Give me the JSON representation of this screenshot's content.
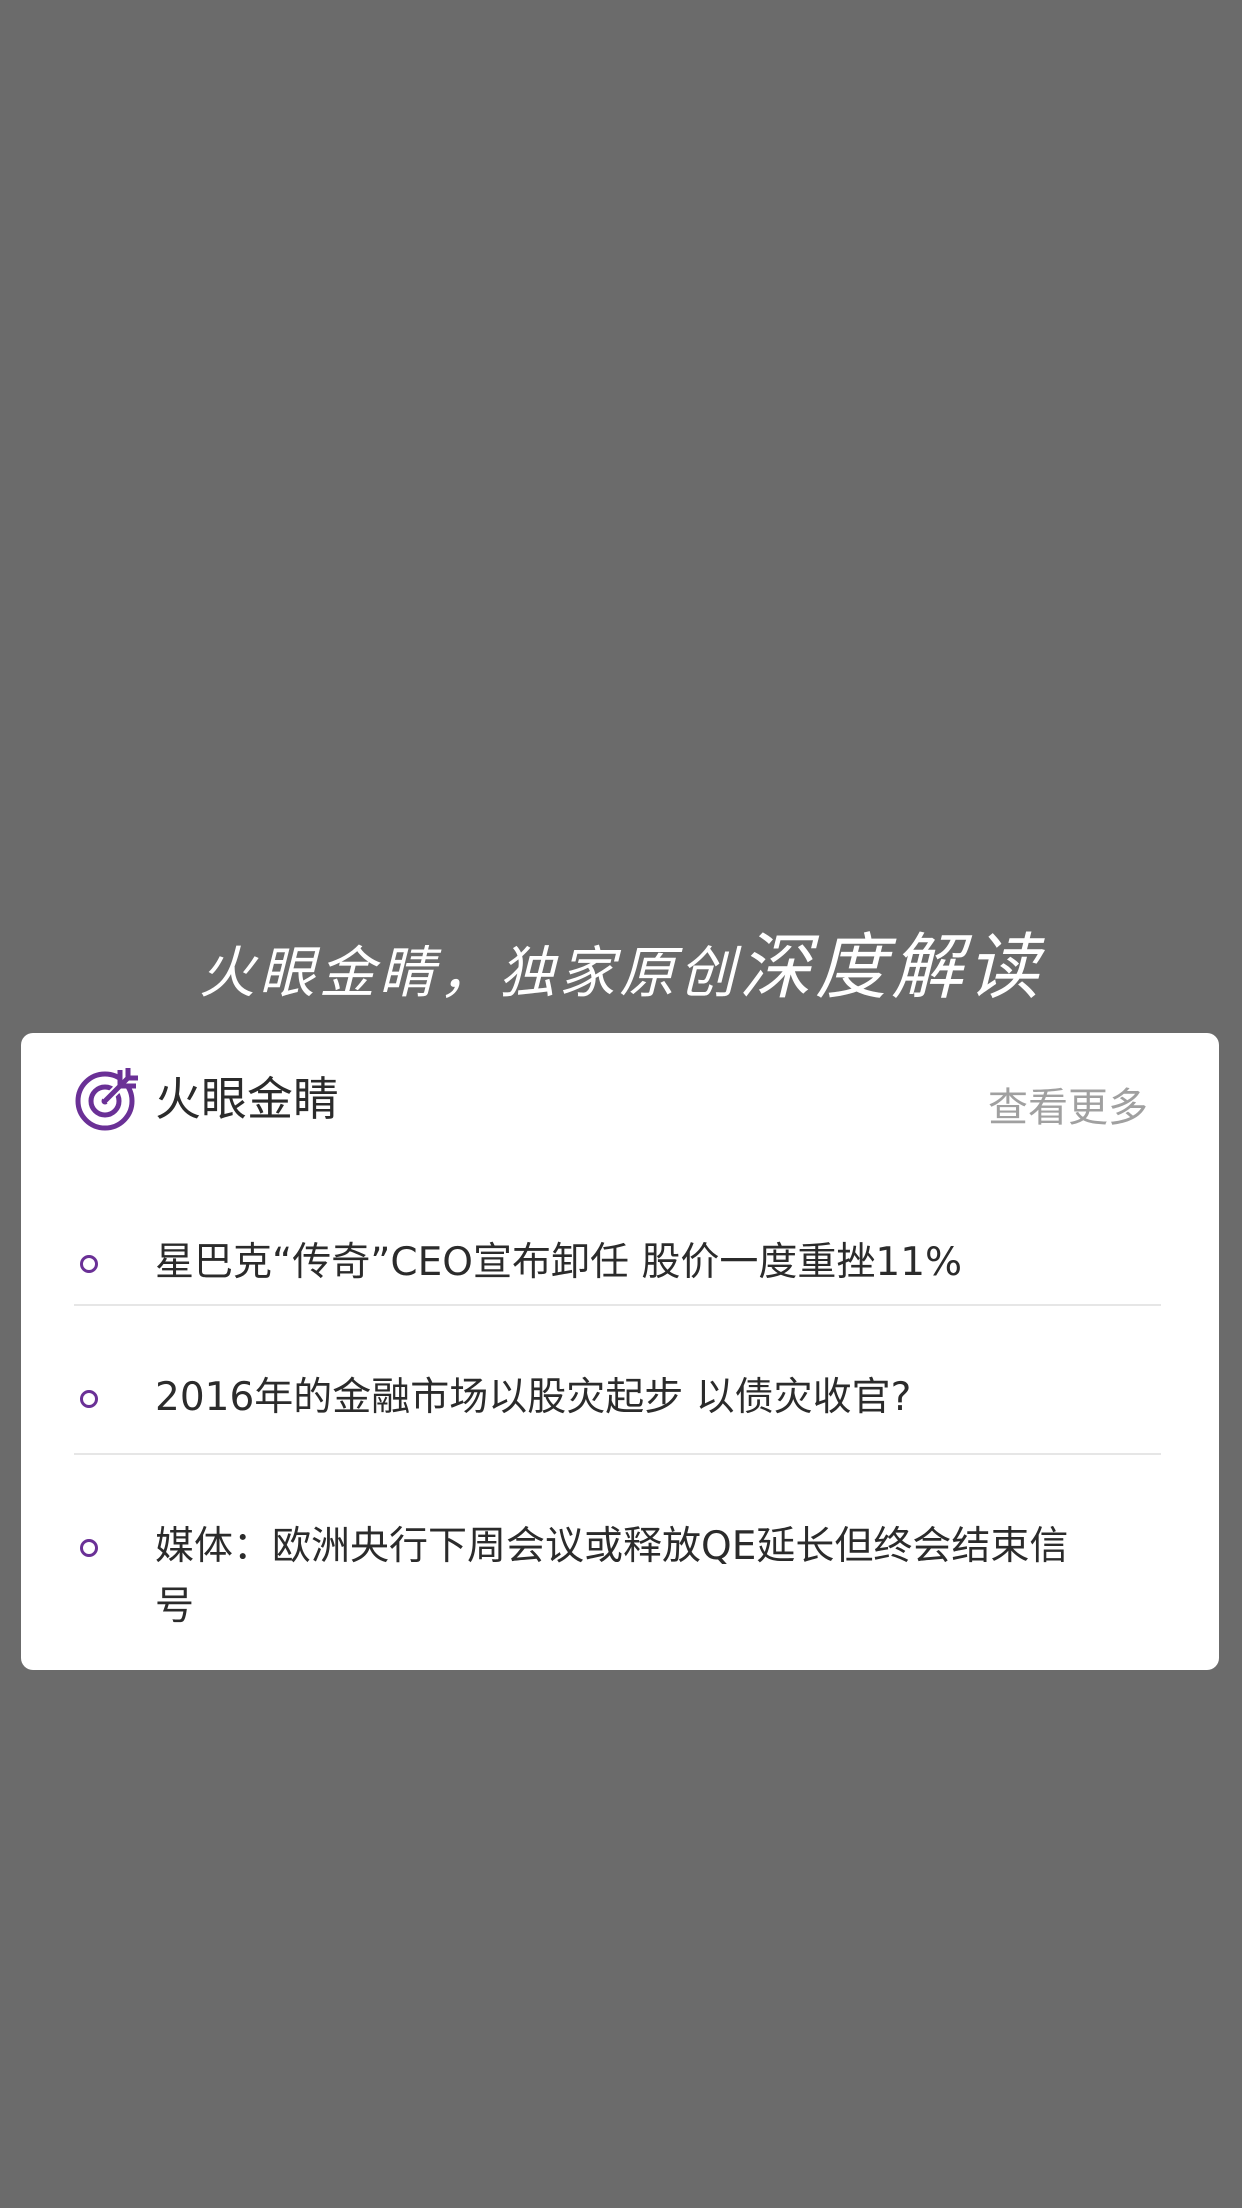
{
  "overlay": {
    "title_part1": "火眼金睛，独家原创",
    "title_part2": "深度解读"
  },
  "card": {
    "icon": "target-arrow-icon",
    "title": "火眼金睛",
    "more_label": "查看更多",
    "accent_color": "#6a3096",
    "items": [
      {
        "text": "星巴克“传奇”CEO宣布卸任 股价一度重挫11%"
      },
      {
        "text": "2016年的金融市场以股灾起步 以债灾收官?"
      },
      {
        "text": "媒体：欧洲央行下周会议或释放QE延长但终会结束信号"
      }
    ]
  }
}
